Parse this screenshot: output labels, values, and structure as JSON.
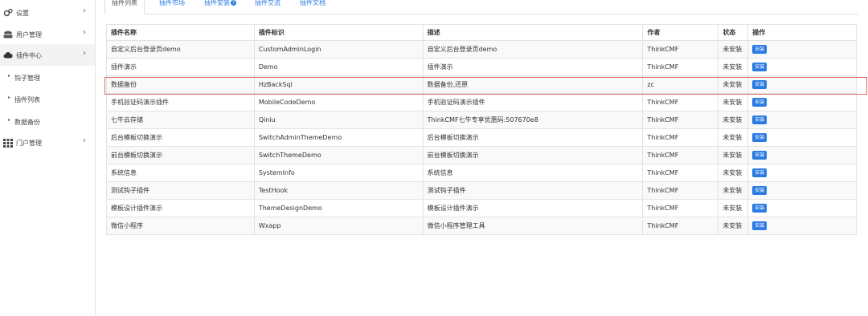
{
  "sidebar": {
    "items": [
      {
        "label": "设置",
        "icon": "gear-icon",
        "chevron": "›"
      },
      {
        "label": "用户管理",
        "icon": "users-icon",
        "chevron": "›"
      },
      {
        "label": "插件中心",
        "icon": "cloud-icon",
        "chevron": "›"
      },
      {
        "label": "钩子管理"
      },
      {
        "label": "插件列表"
      },
      {
        "label": "数据备份"
      },
      {
        "label": "门户管理",
        "icon": "grid-icon",
        "chevron": "›"
      }
    ]
  },
  "tabs": [
    {
      "label": "插件列表"
    },
    {
      "label": "插件市场"
    },
    {
      "label": "插件安装",
      "help": "?"
    },
    {
      "label": "插件交流"
    },
    {
      "label": "插件文档"
    }
  ],
  "table": {
    "headers": [
      "插件名称",
      "插件标识",
      "描述",
      "作者",
      "状态",
      "操作"
    ],
    "rows": [
      {
        "name": "自定义后台登录页demo",
        "id": "CustomAdminLogin",
        "desc": "自定义后台登录页demo",
        "author": "ThinkCMF",
        "status": "未安装",
        "action": "安装"
      },
      {
        "name": "插件演示",
        "id": "Demo",
        "desc": "插件演示",
        "author": "ThinkCMF",
        "status": "未安装",
        "action": "安装"
      },
      {
        "name": "数据备份",
        "id": "HzBackSql",
        "desc": "数据备份,还原",
        "author": "zc",
        "status": "未安装",
        "action": "安装"
      },
      {
        "name": "手机验证码演示插件",
        "id": "MobileCodeDemo",
        "desc": "手机验证码演示插件",
        "author": "ThinkCMF",
        "status": "未安装",
        "action": "安装"
      },
      {
        "name": "七牛云存储",
        "id": "Qiniu",
        "desc": "ThinkCMF七牛专享优惠码:507670e8",
        "author": "ThinkCMF",
        "status": "未安装",
        "action": "安装"
      },
      {
        "name": "后台模板切换演示",
        "id": "SwitchAdminThemeDemo",
        "desc": "后台模板切换演示",
        "author": "ThinkCMF",
        "status": "未安装",
        "action": "安装"
      },
      {
        "name": "前台模板切换演示",
        "id": "SwitchThemeDemo",
        "desc": "前台模板切换演示",
        "author": "ThinkCMF",
        "status": "未安装",
        "action": "安装"
      },
      {
        "name": "系统信息",
        "id": "SystemInfo",
        "desc": "系统信息",
        "author": "ThinkCMF",
        "status": "未安装",
        "action": "安装"
      },
      {
        "name": "测试钩子插件",
        "id": "TestHook",
        "desc": "测试钩子插件",
        "author": "ThinkCMF",
        "status": "未安装",
        "action": "安装"
      },
      {
        "name": "模板设计插件演示",
        "id": "ThemeDesignDemo",
        "desc": "模板设计插件演示",
        "author": "ThinkCMF",
        "status": "未安装",
        "action": "安装"
      },
      {
        "name": "微信小程序",
        "id": "Wxapp",
        "desc": "微信小程序管理工具",
        "author": "ThinkCMF",
        "status": "未安装",
        "action": "安装"
      }
    ]
  },
  "colors": {
    "accent": "#2a7ae2",
    "highlight_border": "#e06a6a"
  }
}
